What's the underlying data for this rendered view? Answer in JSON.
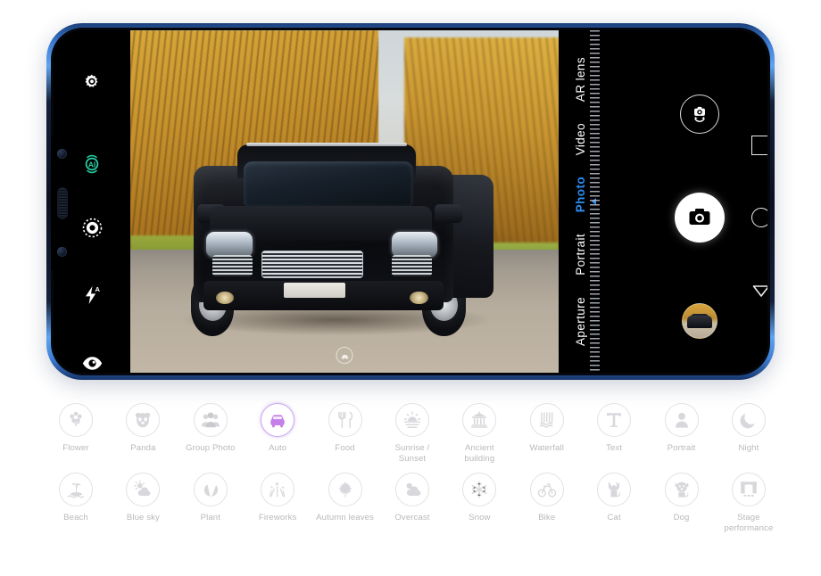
{
  "device": {
    "name": "smartphone-landscape",
    "frame_color": "#3f7fd6",
    "screen_background": "#000000"
  },
  "camera_ui": {
    "left_toolbar": [
      {
        "icon": "settings-gear-icon",
        "name": "settings",
        "label": "Settings"
      },
      {
        "icon": "ai-master-icon",
        "name": "ai-master",
        "label": "AI",
        "color": "#24c49a",
        "active": true
      },
      {
        "icon": "filter-icon",
        "name": "filter",
        "label": "Filter"
      },
      {
        "icon": "flash-auto-icon",
        "name": "flash",
        "label": "Flash Auto"
      },
      {
        "icon": "beauty-eye-icon",
        "name": "beauty",
        "label": "Beauty"
      }
    ],
    "modes": [
      {
        "label": "AR lens",
        "active": false
      },
      {
        "label": "Video",
        "active": false
      },
      {
        "label": "Photo",
        "active": true
      },
      {
        "label": "Portrait",
        "active": false
      },
      {
        "label": "Aperture",
        "active": false
      }
    ],
    "active_mode_color": "#2a8df2",
    "right_controls": [
      {
        "icon": "camera-flip-icon",
        "name": "switch-camera",
        "label": "Switch camera"
      },
      {
        "icon": "shutter-camera-icon",
        "name": "shutter",
        "label": "Shutter"
      },
      {
        "icon": "gallery-thumbnail",
        "name": "gallery",
        "label": "Gallery"
      }
    ],
    "nav_bar": [
      {
        "icon": "recents-square-icon",
        "name": "recents",
        "label": "Recents"
      },
      {
        "icon": "home-circle-icon",
        "name": "home",
        "label": "Home"
      },
      {
        "icon": "back-triangle-icon",
        "name": "back",
        "label": "Back"
      }
    ],
    "viewfinder": {
      "scene_badge_icon": "car-badge-icon",
      "scene_badge_label": "Auto"
    }
  },
  "scene_recognition": {
    "rows": [
      [
        {
          "label": "Flower",
          "icon": "flower-icon",
          "active": false
        },
        {
          "label": "Panda",
          "icon": "panda-icon",
          "active": false
        },
        {
          "label": "Group Photo",
          "icon": "group-photo-icon",
          "active": false
        },
        {
          "label": "Auto",
          "icon": "car-icon",
          "active": true
        },
        {
          "label": "Food",
          "icon": "food-icon",
          "active": false
        },
        {
          "label": "Sunrise /\nSunset",
          "icon": "sunrise-sunset-icon",
          "active": false
        },
        {
          "label": "Ancient\nbuilding",
          "icon": "ancient-building-icon",
          "active": false
        },
        {
          "label": "Waterfall",
          "icon": "waterfall-icon",
          "active": false
        },
        {
          "label": "Text",
          "icon": "text-icon",
          "active": false
        },
        {
          "label": "Portrait",
          "icon": "portrait-icon",
          "active": false
        },
        {
          "label": "Night",
          "icon": "night-moon-icon",
          "active": false
        }
      ],
      [
        {
          "label": "Beach",
          "icon": "beach-icon",
          "active": false
        },
        {
          "label": "Blue sky",
          "icon": "blue-sky-icon",
          "active": false
        },
        {
          "label": "Plant",
          "icon": "plant-icon",
          "active": false
        },
        {
          "label": "Fireworks",
          "icon": "fireworks-icon",
          "active": false
        },
        {
          "label": "Autumn leaves",
          "icon": "autumn-leaves-icon",
          "active": false
        },
        {
          "label": "Overcast",
          "icon": "overcast-icon",
          "active": false
        },
        {
          "label": "Snow",
          "icon": "snow-icon",
          "active": false
        },
        {
          "label": "Bike",
          "icon": "bike-icon",
          "active": false
        },
        {
          "label": "Cat",
          "icon": "cat-icon",
          "active": false
        },
        {
          "label": "Dog",
          "icon": "dog-icon",
          "active": false
        },
        {
          "label": "Stage\nperformance",
          "icon": "stage-performance-icon",
          "active": false
        }
      ]
    ],
    "active_color": "#c080e8",
    "inactive_color": "#d8d8dc",
    "label_color": "#b9b9bd"
  }
}
